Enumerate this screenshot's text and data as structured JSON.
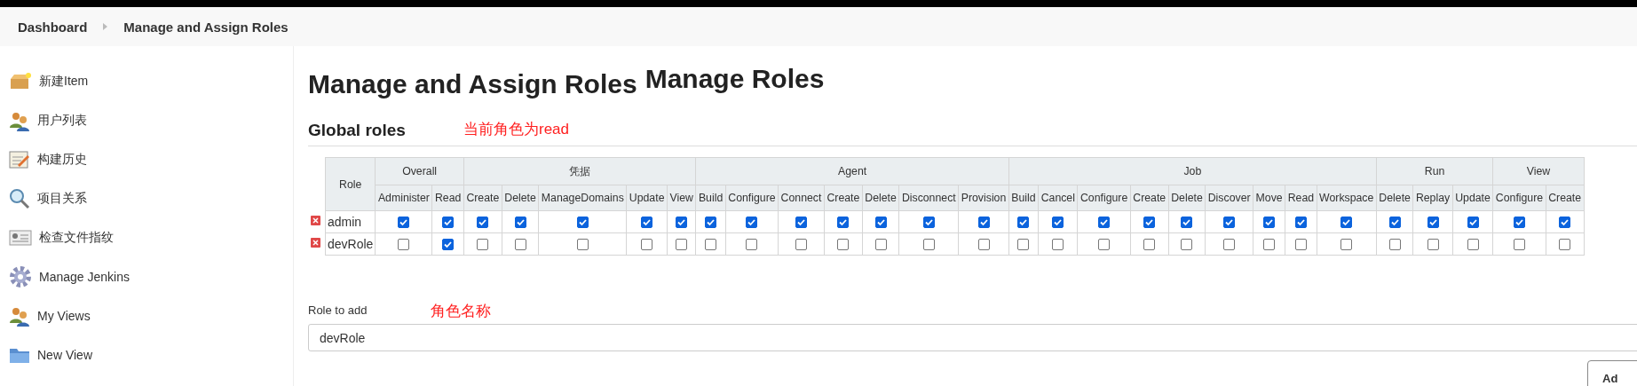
{
  "breadcrumbs": [
    {
      "label": "Dashboard"
    },
    {
      "label": "Manage and Assign Roles"
    }
  ],
  "sidebar": {
    "items": [
      {
        "label": "新建Item"
      },
      {
        "label": "用户列表"
      },
      {
        "label": "构建历史"
      },
      {
        "label": "项目关系"
      },
      {
        "label": "检查文件指纹"
      },
      {
        "label": "Manage Jenkins"
      },
      {
        "label": "My Views"
      },
      {
        "label": "New View"
      }
    ]
  },
  "page_title": "Manage and Assign Roles",
  "section_title": "Manage Roles",
  "global_roles": {
    "title": "Global roles",
    "role_header": "Role",
    "groups": [
      {
        "name": "Overall",
        "permissions": [
          "Administer",
          "Read"
        ]
      },
      {
        "name": "凭据",
        "permissions": [
          "Create",
          "Delete",
          "ManageDomains",
          "Update",
          "View"
        ]
      },
      {
        "name": "Agent",
        "permissions": [
          "Build",
          "Configure",
          "Connect",
          "Create",
          "Delete",
          "Disconnect",
          "Provision"
        ]
      },
      {
        "name": "Job",
        "permissions": [
          "Build",
          "Cancel",
          "Configure",
          "Create",
          "Delete",
          "Discover",
          "Move",
          "Read",
          "Workspace"
        ]
      },
      {
        "name": "Run",
        "permissions": [
          "Delete",
          "Replay",
          "Update"
        ]
      },
      {
        "name": "View",
        "permissions": [
          "Configure",
          "Create"
        ]
      }
    ],
    "rows": [
      {
        "name": "admin",
        "checks": [
          true,
          true,
          true,
          true,
          true,
          true,
          true,
          true,
          true,
          true,
          true,
          true,
          true,
          true,
          true,
          true,
          true,
          true,
          true,
          true,
          true,
          true,
          true,
          true,
          true,
          true,
          true,
          true
        ]
      },
      {
        "name": "devRole",
        "checks": [
          false,
          true,
          false,
          false,
          false,
          false,
          false,
          false,
          false,
          false,
          false,
          false,
          false,
          false,
          false,
          false,
          false,
          false,
          false,
          false,
          false,
          false,
          false,
          false,
          false,
          false,
          false,
          false
        ]
      }
    ]
  },
  "role_to_add": {
    "label": "Role to add",
    "value": "devRole"
  },
  "add_button": "Ad",
  "annotations": [
    {
      "text": "当前角色为read"
    },
    {
      "text": "角色名称"
    }
  ]
}
